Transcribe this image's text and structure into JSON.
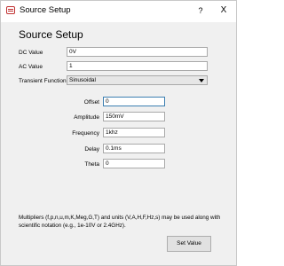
{
  "window": {
    "title": "Source Setup",
    "help": "?",
    "close": "X"
  },
  "heading": "Source Setup",
  "fields": {
    "dc_value": {
      "label": "DC Value",
      "value": "0V"
    },
    "ac_value": {
      "label": "AC Value",
      "value": "1"
    },
    "transient_function": {
      "label": "Transient Function",
      "value": "Sinusoidal"
    },
    "offset": {
      "label": "Offset",
      "value": "0"
    },
    "amplitude": {
      "label": "Amplitude",
      "value": "150mV"
    },
    "frequency": {
      "label": "Frequency",
      "value": "1khz"
    },
    "delay": {
      "label": "Delay",
      "value": "0.1ms"
    },
    "theta": {
      "label": "Theta",
      "value": "0"
    }
  },
  "note": "Multipliers (f,p,n,u,m,K,Meg,G,T) and units (V,A,H,F,Hz,s) may be used along with scientific notation (e.g., 1e-10V or 2.4GHz).",
  "buttons": {
    "set_value": "Set Value"
  }
}
